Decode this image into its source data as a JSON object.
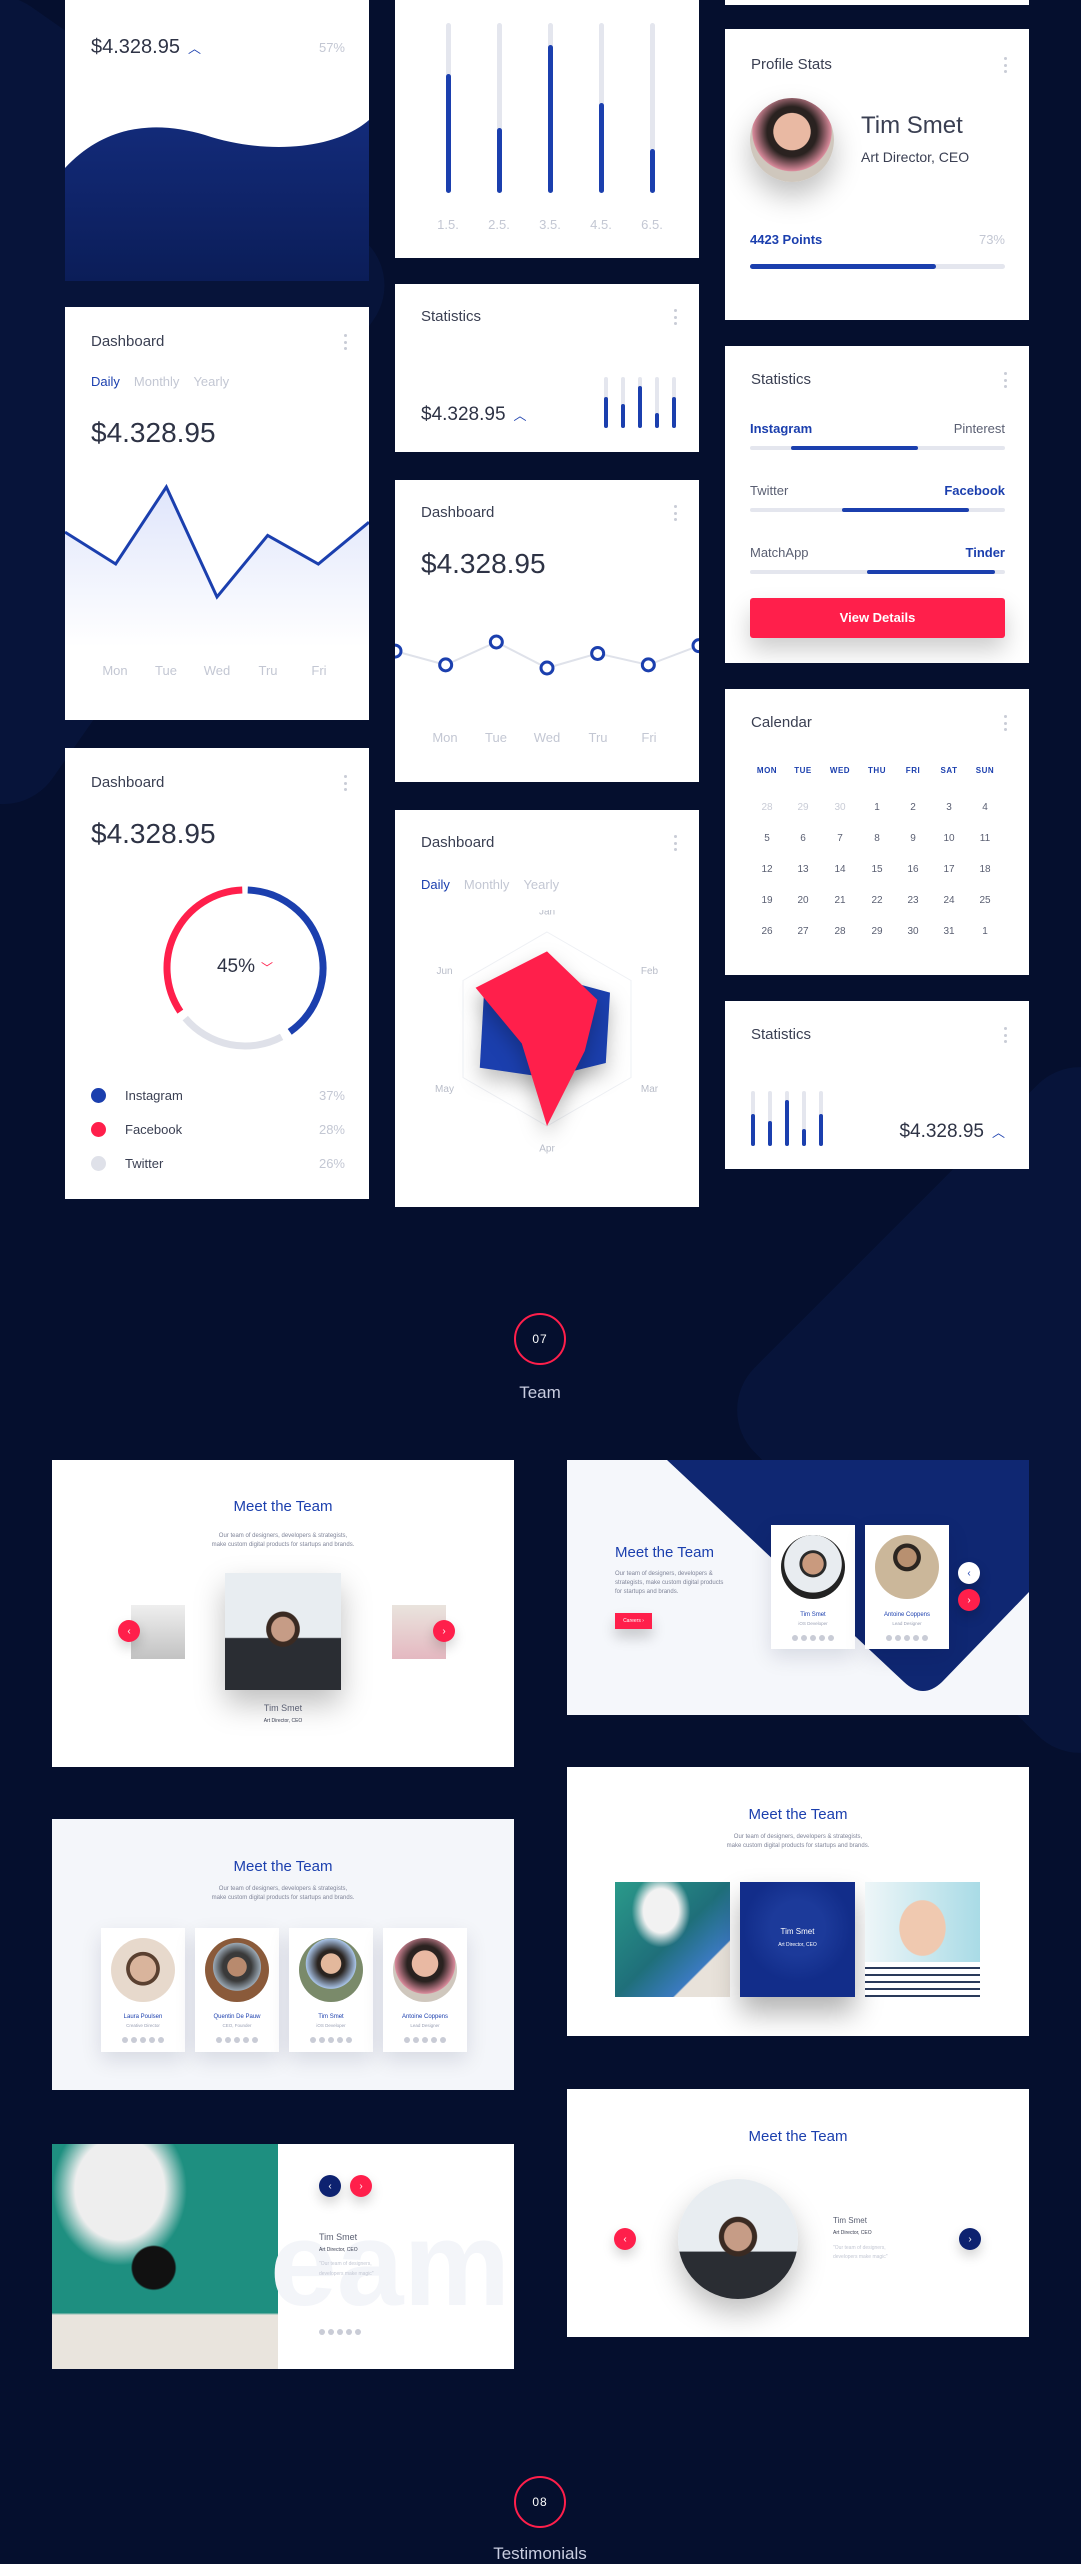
{
  "colors": {
    "background": "#050f2e",
    "primary": "#1b3fae",
    "navy": "#0d2270",
    "accent": "#ff1f4b",
    "track": "#e4e6ee"
  },
  "wave_card": {
    "amount": "$4.328.95",
    "trend_icon": "caret-up-icon",
    "percent": "57%"
  },
  "bar_card": {
    "labels": [
      "1.5.",
      "2.5.",
      "3.5.",
      "4.5.",
      "6.5."
    ],
    "values": [
      0.7,
      0.38,
      0.87,
      0.53,
      0.26
    ]
  },
  "line_card": {
    "title": "Dashboard",
    "tabs": [
      "Daily",
      "Monthly",
      "Yearly"
    ],
    "active_tab": "Daily",
    "amount": "$4.328.95",
    "days": [
      "Mon",
      "Tue",
      "Wed",
      "Tru",
      "Fri"
    ],
    "values": [
      59,
      30,
      100,
      0,
      56,
      30,
      68
    ]
  },
  "stats_small": {
    "title": "Statistics",
    "amount": "$4.328.95",
    "values": [
      0.61,
      0.47,
      0.83,
      0.29,
      0.6
    ]
  },
  "circles_card": {
    "title": "Dashboard",
    "amount": "$4.328.95",
    "days": [
      "Mon",
      "Tue",
      "Wed",
      "Tru",
      "Fri"
    ],
    "values": [
      65,
      12,
      100,
      0,
      56,
      12,
      86
    ]
  },
  "donut_card": {
    "title": "Dashboard",
    "amount": "$4.328.95",
    "center": "45%",
    "trend_icon": "caret-down-icon",
    "legend": [
      {
        "name": "Instagram",
        "value": "37%",
        "color": "#1b3fae"
      },
      {
        "name": "Facebook",
        "value": "28%",
        "color": "#ff1f4b"
      },
      {
        "name": "Twitter",
        "value": "26%",
        "color": "#dfe1e9"
      }
    ]
  },
  "radar_card": {
    "title": "Dashboard",
    "tabs": [
      "Daily",
      "Monthly",
      "Yearly"
    ],
    "active_tab": "Daily",
    "axes": [
      "Jan",
      "Feb",
      "Mar",
      "Apr",
      "May",
      "Jun"
    ],
    "series": [
      {
        "color": "#1b3fae",
        "values": [
          0.55,
          0.75,
          0.7,
          0.5,
          0.8,
          0.75
        ]
      },
      {
        "color": "#ff1f4b",
        "values": [
          0.8,
          0.6,
          0.45,
          1.0,
          0.3,
          0.85
        ]
      }
    ]
  },
  "profile": {
    "title": "Profile Stats",
    "name": "Tim Smet",
    "role": "Art Director, CEO",
    "points": "4423 Points",
    "percent": "73%",
    "progress": 0.73
  },
  "social": {
    "title": "Statistics",
    "rows": [
      {
        "left": "Instagram",
        "right": "Pinterest",
        "active": "left",
        "range": [
          0.16,
          0.66
        ]
      },
      {
        "left": "Twitter",
        "right": "Facebook",
        "active": "right",
        "range": [
          0.36,
          0.86
        ]
      },
      {
        "left": "MatchApp",
        "right": "Tinder",
        "active": "right",
        "range": [
          0.46,
          0.96
        ]
      }
    ],
    "button": "View Details"
  },
  "calendar": {
    "title": "Calendar",
    "weekdays": [
      "MON",
      "TUE",
      "WED",
      "THU",
      "FRI",
      "SAT",
      "SUN"
    ],
    "weeks": [
      [
        "28",
        "29",
        "30",
        "1",
        "2",
        "3",
        "4"
      ],
      [
        "5",
        "6",
        "7",
        "8",
        "9",
        "10",
        "11"
      ],
      [
        "12",
        "13",
        "14",
        "15",
        "16",
        "17",
        "18"
      ],
      [
        "19",
        "20",
        "21",
        "22",
        "23",
        "24",
        "25"
      ],
      [
        "26",
        "27",
        "28",
        "29",
        "30",
        "31",
        "1"
      ]
    ]
  },
  "stats_small2": {
    "title": "Statistics",
    "amount": "$4.328.95",
    "values": [
      0.59,
      0.46,
      0.83,
      0.31,
      0.59
    ]
  },
  "section_team": {
    "number": "07",
    "label": "Team"
  },
  "section_testimonials": {
    "number": "08",
    "label": "Testimonials"
  },
  "team": {
    "title": "Meet the Team",
    "subtitle_1": "Our team of designers, developers & strategists,",
    "subtitle_2": "make custom digital products for startups and brands.",
    "subtitle_block": [
      "Our team of designers, developers &",
      "strategists, make custom digital products",
      "for startups and brands."
    ],
    "careers": "Careers",
    "featured": {
      "name": "Tim Smet",
      "role": "Art Director, CEO",
      "quote_1": "\"Our team of designers,",
      "quote_2": "developers make magic\""
    },
    "watermark": "eam",
    "pair": [
      {
        "name": "Tim Smet",
        "role": "iOS Developer"
      },
      {
        "name": "Antoine Coppens",
        "role": "Lead Designer"
      }
    ],
    "members": [
      {
        "name": "Laura Poulsen",
        "role": "Creative Director"
      },
      {
        "name": "Quentin De Pauw",
        "role": "CEO, Founder"
      },
      {
        "name": "Tim Smet",
        "role": "iOS Developer"
      },
      {
        "name": "Antoine Coppens",
        "role": "Lead Designer"
      }
    ],
    "social_icons": [
      "mail-icon",
      "pinterest-icon",
      "instagram-icon",
      "twitter-icon",
      "facebook-icon"
    ]
  }
}
